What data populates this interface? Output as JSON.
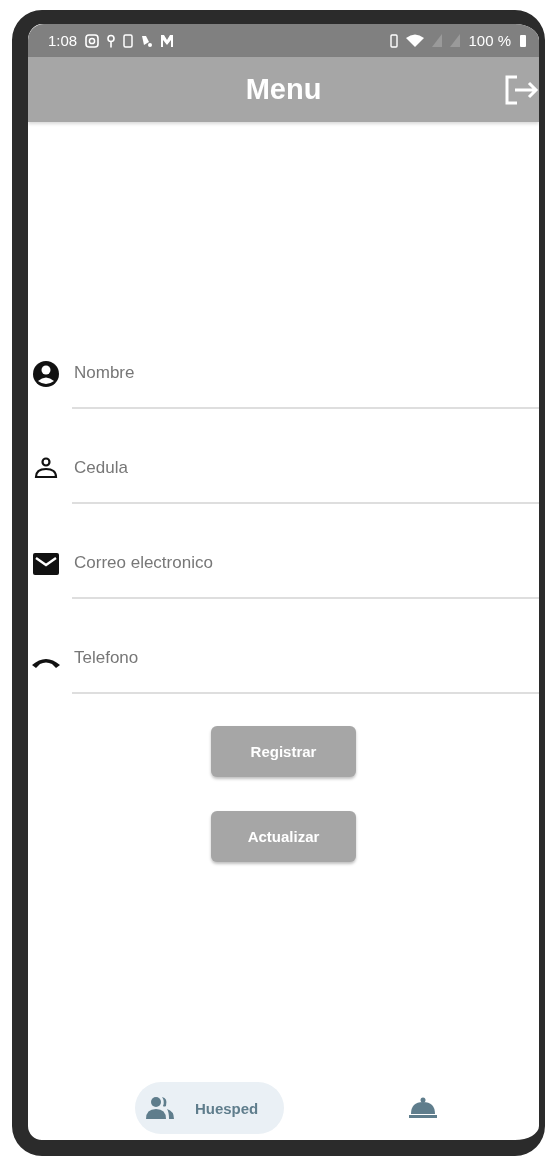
{
  "status_bar": {
    "time": "1:08",
    "battery": "100 %"
  },
  "app_bar": {
    "title": "Menu"
  },
  "fields": [
    {
      "placeholder": "Nombre"
    },
    {
      "placeholder": "Cedula"
    },
    {
      "placeholder": "Correo electronico"
    },
    {
      "placeholder": "Telefono"
    }
  ],
  "buttons": [
    "Registrar",
    "Actualizar"
  ],
  "bottom_nav": [
    {
      "label": "Huesped",
      "selected": true
    },
    {
      "selected": false
    }
  ]
}
